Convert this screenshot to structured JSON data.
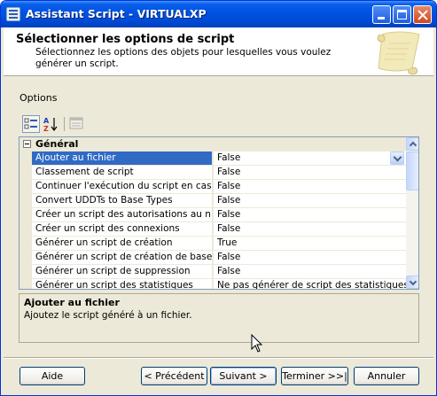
{
  "window": {
    "title": "Assistant Script - VIRTUALXP"
  },
  "header": {
    "title": "Sélectionner les options de script",
    "subtitle": "Sélectionnez les options des objets pour lesquelles vous voulez générer un script."
  },
  "options_label": "Options",
  "grid": {
    "category": "Général",
    "rows": [
      {
        "name": "Ajouter au fichier",
        "value": "False"
      },
      {
        "name": "Classement de script",
        "value": "False"
      },
      {
        "name": "Continuer l'exécution du script en cas d'erreur",
        "value": "False"
      },
      {
        "name": "Convert UDDTs to Base Types",
        "value": "False"
      },
      {
        "name": "Créer un script des autorisations au niveau objet",
        "value": "False"
      },
      {
        "name": "Créer un script des connexions",
        "value": "False"
      },
      {
        "name": "Générer un script de création",
        "value": "True"
      },
      {
        "name": "Générer un script de création de base de données",
        "value": "False"
      },
      {
        "name": "Générer un script de suppression",
        "value": "False"
      },
      {
        "name": "Générer un script des statistiques",
        "value": "Ne pas générer de script des statistiques"
      }
    ]
  },
  "description": {
    "title": "Ajouter au fichier",
    "text": "Ajoutez le script généré à un fichier."
  },
  "buttons": {
    "help": "Aide",
    "previous": "< Précédent",
    "next": "Suivant >",
    "finish": "Terminer >>|",
    "cancel": "Annuler"
  }
}
